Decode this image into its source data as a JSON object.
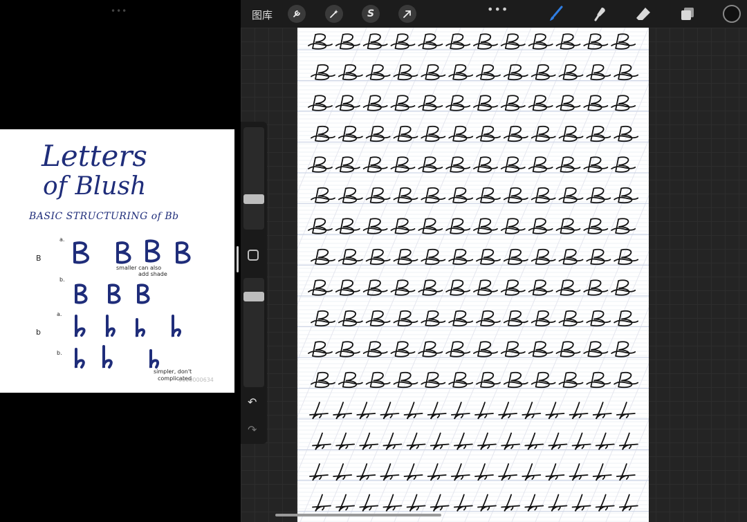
{
  "split": {
    "handle": "•••"
  },
  "reference": {
    "title_line1": "Letters",
    "title_line2": "of Blush",
    "subtitle": "BASIC STRUCTURING of Bb",
    "notes": [
      "smaller can also",
      "add shade",
      "simpler, don't",
      "complicated"
    ],
    "watermark": "0000000634"
  },
  "toolbar": {
    "gallery_label": "图库",
    "tools": [
      {
        "name": "actions",
        "icon": "wrench-icon",
        "glyph": "🔧"
      },
      {
        "name": "adjustments",
        "icon": "magic-wand-icon",
        "glyph": "✦"
      },
      {
        "name": "selection",
        "icon": "selection-icon",
        "glyph": "S"
      },
      {
        "name": "transform",
        "icon": "arrow-icon",
        "glyph": "➚"
      }
    ],
    "more": "•••",
    "right_tools": [
      {
        "name": "brush",
        "icon": "brush-icon",
        "color": "#2f7de1"
      },
      {
        "name": "smudge",
        "icon": "smudge-icon",
        "color": "#d8d8d8"
      },
      {
        "name": "eraser",
        "icon": "eraser-icon",
        "color": "#d8d8d8"
      },
      {
        "name": "layers",
        "icon": "layers-icon",
        "color": "#d8d8d8"
      }
    ],
    "active_color": "#111111"
  },
  "sidebar": {
    "undo": "↶",
    "redo": "↷"
  }
}
